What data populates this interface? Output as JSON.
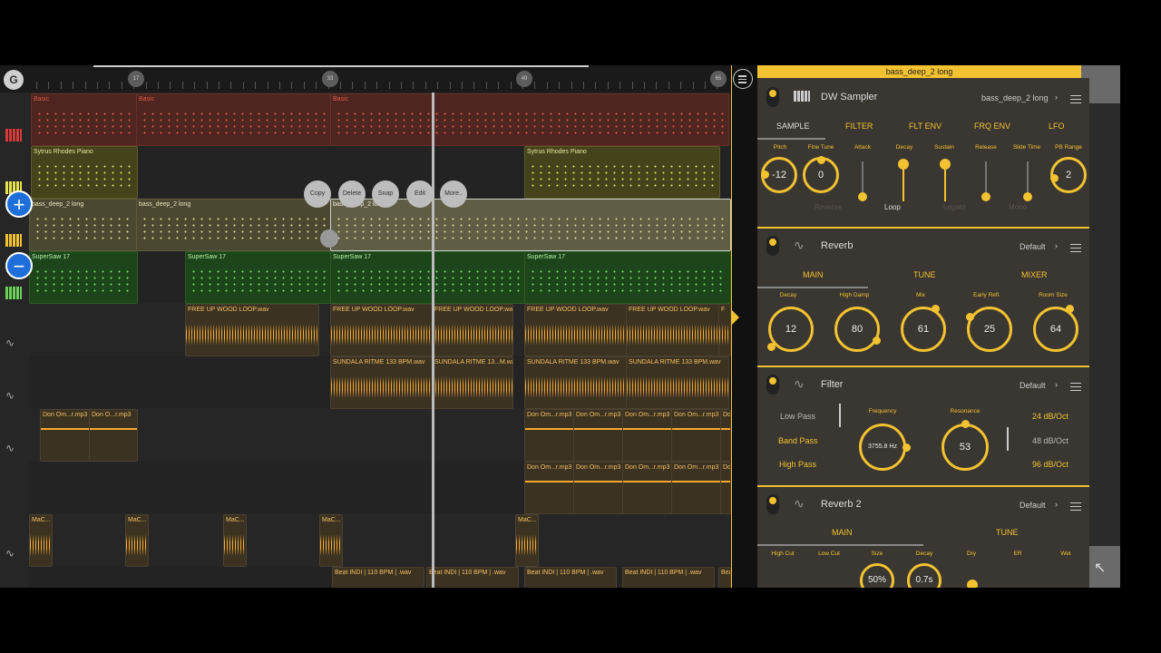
{
  "ruler": {
    "markers": [
      "17",
      "33",
      "49",
      "65"
    ]
  },
  "context_menu": {
    "copy": "Copy",
    "delete": "Delete",
    "snap": "Snap",
    "edit": "Edit",
    "more": "More.."
  },
  "zoom": {
    "plus": "+",
    "minus": "−"
  },
  "tracks": {
    "basic_label": "Basic",
    "rhodes_label": "Sytrus Rhodes Piano",
    "bass_label": "bass_deep_2 long",
    "supersaw_label": "SuperSaw 17",
    "wood_label": "FREE UP WOOD LOOP.wav",
    "sundala_label": "SUNDALA RITME 133 BPM.wav",
    "sundala_short": "SUNDALA RITME 13...M.wav",
    "don_label": "Don Om...r.mp3",
    "don_short": "Don O...r.mp3",
    "mac_label": "MaC...",
    "beat_label": "Beat INDI | 110 BPM | .wav",
    "f_short": "F"
  },
  "panel": {
    "header": "bass_deep_2 long",
    "sampler": {
      "title": "DW Sampler",
      "preset": "bass_deep_2 long",
      "tabs": [
        "SAMPLE",
        "FILTER",
        "FLT ENV",
        "FRQ ENV",
        "LFO"
      ],
      "params": [
        "Pitch",
        "Fine Tune",
        "Attack",
        "Decay",
        "Sustain",
        "Release",
        "Slide Time",
        "PB Range"
      ],
      "pitch": "-12",
      "finetune": "0",
      "pbrange": "2",
      "toggles": [
        "Reverse",
        "Loop",
        "Legato",
        "Mono"
      ]
    },
    "reverb": {
      "title": "Reverb",
      "preset": "Default",
      "tabs": [
        "MAIN",
        "TUNE",
        "MIXER"
      ],
      "params": [
        "Decay",
        "High Damp",
        "Mix",
        "Early Refl.",
        "Room Size"
      ],
      "values": [
        "12",
        "80",
        "61",
        "25",
        "64"
      ]
    },
    "filter": {
      "title": "Filter",
      "preset": "Default",
      "types": [
        "Low Pass",
        "Band Pass",
        "High Pass"
      ],
      "frequency_label": "Frequency",
      "frequency_value": "3755.8 Hz",
      "resonance_label": "Resonance",
      "resonance_value": "53",
      "slopes": [
        "24 dB/Oct",
        "48 dB/Oct",
        "96 dB/Oct"
      ]
    },
    "reverb2": {
      "title": "Reverb 2",
      "preset": "Default",
      "tabs": [
        "MAIN",
        "TUNE"
      ],
      "params": [
        "High Cut",
        "Low Cut",
        "Size",
        "Decay",
        "Dry",
        "ER",
        "Wet"
      ],
      "size": "50%",
      "decay": "0.7s"
    }
  },
  "colors": {
    "accent": "#f2c230",
    "basic": "#5a2a22",
    "rhodes": "#4c4a1e",
    "bass": "#4a4a2c",
    "supersaw": "#1f4a1c",
    "audio": "#3b3222"
  }
}
